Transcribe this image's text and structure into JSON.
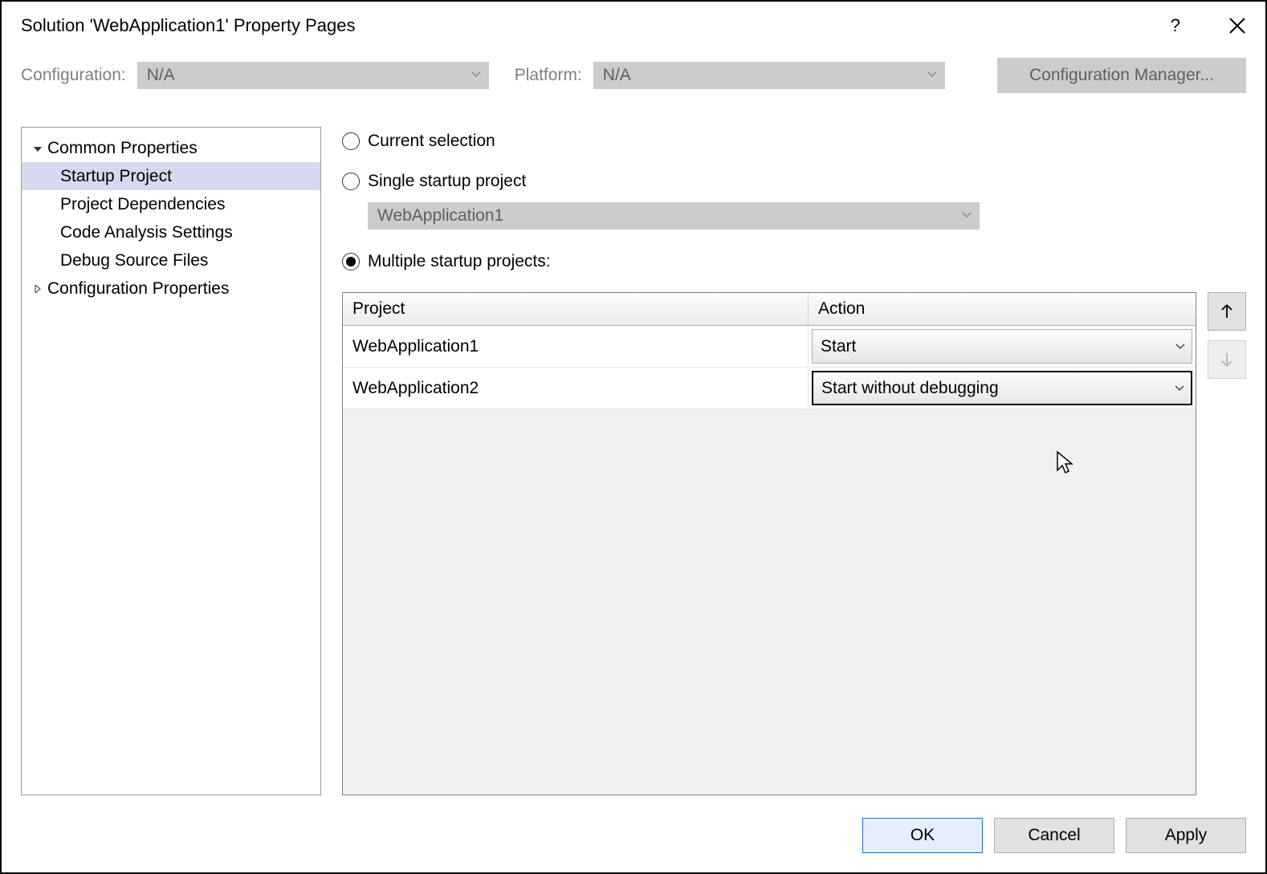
{
  "titlebar": {
    "title": "Solution 'WebApplication1' Property Pages",
    "help": "?",
    "close": "×"
  },
  "toolbar": {
    "configuration_label": "Configuration:",
    "configuration_value": "N/A",
    "platform_label": "Platform:",
    "platform_value": "N/A",
    "config_manager_label": "Configuration Manager..."
  },
  "tree": {
    "items": [
      {
        "label": "Common Properties",
        "level": 0,
        "expanded": true
      },
      {
        "label": "Startup Project",
        "level": 1,
        "selected": true
      },
      {
        "label": "Project Dependencies",
        "level": 1
      },
      {
        "label": "Code Analysis Settings",
        "level": 1
      },
      {
        "label": "Debug Source Files",
        "level": 1
      },
      {
        "label": "Configuration Properties",
        "level": 0,
        "expanded": false
      }
    ]
  },
  "startup": {
    "radio_current": "Current selection",
    "radio_single": "Single startup project",
    "single_value": "WebApplication1",
    "radio_multiple": "Multiple startup projects:",
    "grid": {
      "header_project": "Project",
      "header_action": "Action",
      "rows": [
        {
          "project": "WebApplication1",
          "action": "Start"
        },
        {
          "project": "WebApplication2",
          "action": "Start without debugging"
        }
      ]
    }
  },
  "buttons": {
    "ok": "OK",
    "cancel": "Cancel",
    "apply": "Apply"
  }
}
